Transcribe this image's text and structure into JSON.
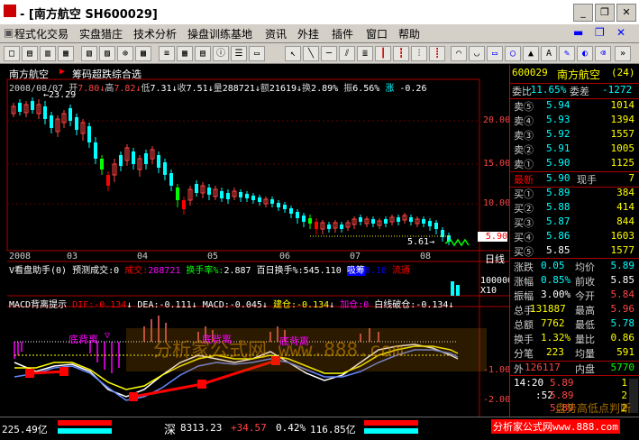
{
  "window": {
    "title": "- [南方航空  SH600029]"
  },
  "menu": [
    "程式化交易",
    "实盘猎庄",
    "技术分析",
    "操盘训练基地",
    "资讯",
    "外挂",
    "插件",
    "窗口",
    "帮助"
  ],
  "stock": {
    "name": "南方航空",
    "indicator_name": "筹码超跌综合选",
    "date": "2008/08/07",
    "open_label": "开",
    "open": "7.80",
    "high_label": "高",
    "high": "7.82",
    "low_label": "低",
    "low": "7.31",
    "close_label": "收",
    "close": "7.51",
    "vol_label": "量",
    "vol": "288721",
    "amt_label": "额",
    "amt": "21619",
    "turn_label": "换",
    "turn": "2.89%",
    "amp_label": "振",
    "amp": "6.56%",
    "chg_label": "涨",
    "chg": "-0.26"
  },
  "price_axis": [
    "20.00",
    "15.00",
    "10.00",
    "5.90"
  ],
  "max_label": "23.29",
  "min_label": "5.61",
  "months": [
    "2008",
    "03",
    "04",
    "05",
    "06",
    "07",
    "08"
  ],
  "day_label": "日线",
  "vol_panel": {
    "title": "V看盘助手(0)",
    "pred_label": "预测成交:0",
    "deal_label": "成交:",
    "deal": "288721",
    "turn_label": "换手率%:",
    "turn": "2.887",
    "avg_label": "百日换手%:",
    "avg": "545.110",
    "w1": "吸筹",
    "w1v": "0.18",
    "w2": "流通",
    "ticks": [
      "100000",
      "X10"
    ]
  },
  "macd_panel": {
    "title": "MACD背离提示",
    "dif": "DIF:-0.134",
    "dea": "DEA:-0.111",
    "macd": "MACD:-0.045",
    "jc": "建仓:-0.134",
    "jm": "加仓:0",
    "bx": "白线破仓:-0.134",
    "ticks": [
      "-1.00",
      "-2.00"
    ]
  },
  "markers": [
    "底背离",
    "底背离",
    "底背离"
  ],
  "watermark": "分析家公式网 www.888.com",
  "quote": {
    "code": "600029",
    "name": "南方航空",
    "pe": "(24)",
    "wb_label": "委比",
    "wb": "-11.65%",
    "wc_label": "委差",
    "wc": "-1272",
    "sell": [
      [
        "卖⑤",
        "5.94",
        "1014"
      ],
      [
        "卖④",
        "5.93",
        "1394"
      ],
      [
        "卖③",
        "5.92",
        "1557"
      ],
      [
        "卖②",
        "5.91",
        "1005"
      ],
      [
        "卖①",
        "5.90",
        "1125"
      ]
    ],
    "latest_label": "最新",
    "latest": "5.90",
    "now_label": "现手",
    "now": "7",
    "buy": [
      [
        "买①",
        "5.89",
        "384"
      ],
      [
        "买②",
        "5.88",
        "414"
      ],
      [
        "买③",
        "5.87",
        "844"
      ],
      [
        "买④",
        "5.86",
        "1603"
      ],
      [
        "买⑤",
        "5.85",
        "1577"
      ]
    ],
    "stats": [
      [
        "涨跌",
        "0.05",
        "均价",
        "5.89"
      ],
      [
        "涨幅",
        "0.85%",
        "前收",
        "5.85"
      ],
      [
        "振幅",
        "3.00%",
        "今开",
        "5.84"
      ],
      [
        "总手",
        "131887",
        "最高",
        "5.96"
      ],
      [
        "总额",
        "7762",
        "最低",
        "5.78"
      ],
      [
        "换手",
        "1.32%",
        "量比",
        "0.86"
      ],
      [
        "分笔",
        "223",
        "均量",
        "591"
      ]
    ],
    "outer_label": "外",
    "outer": "126117",
    "inner_label": "内盘",
    "inner": "5770",
    "ticks": [
      [
        "14:20",
        "5.89",
        "1"
      ],
      [
        ":52",
        "5.89",
        "2"
      ],
      [
        "",
        "5.89",
        "2"
      ]
    ],
    "hint": "盘势高低点判断"
  },
  "status": {
    "left": "225.49亿",
    "sz_label": "深",
    "sz": "8313.23",
    "sz_chg": "+34.57",
    "sz_pct": "0.42%",
    "sz_amt": "116.85亿",
    "site": "分析家公式网www.888.com"
  }
}
